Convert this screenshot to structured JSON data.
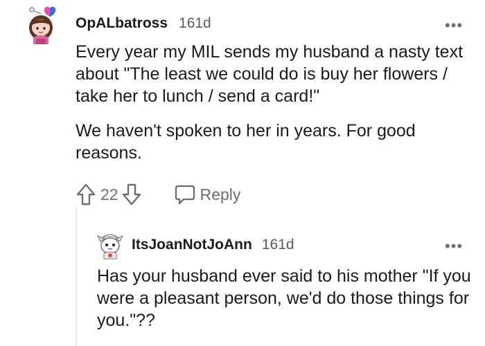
{
  "comment": {
    "author": "OpALbatross",
    "age": "161d",
    "more_label": "•••",
    "paragraphs": [
      "Every year my MIL sends my husband a nasty text about \"The least we could do is buy her flowers / take her to lunch / send a card!\"",
      "We haven't spoken to her in years. For good reasons."
    ],
    "score": "22",
    "reply_label": "Reply",
    "avatar_icon": "snoo-avatar-with-heart-icon",
    "colors": {
      "text": "#1a1a1b",
      "meta": "#555b5e",
      "icon": "#6a6e70"
    }
  },
  "reply": {
    "author": "ItsJoanNotJoAnn",
    "age": "161d",
    "more_label": "•••",
    "text": "Has your husband ever said to his mother \"If you were a pleasant person, we'd do those things for you.\"??",
    "avatar_icon": "snoo-avatar-icon"
  }
}
